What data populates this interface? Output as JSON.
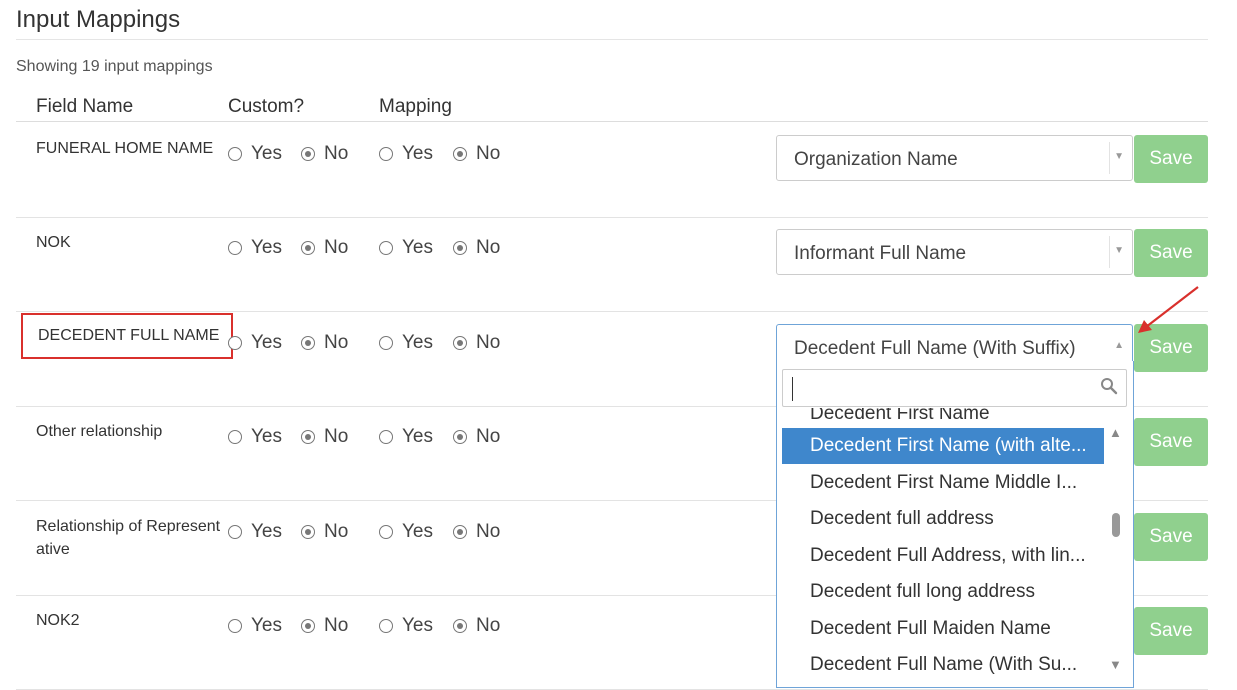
{
  "page": {
    "title": "Input Mappings",
    "count_text": "Showing 19 input mappings",
    "columns": {
      "field_name": "Field Name",
      "custom": "Custom?",
      "mapping": "Mapping"
    }
  },
  "radio_labels": {
    "yes": "Yes",
    "no": "No"
  },
  "rows": [
    {
      "field_name": "FUNERAL HOME NAME",
      "custom": "No",
      "mapping": "No",
      "select_value": "Organization Name",
      "save_label": "Save"
    },
    {
      "field_name": "NOK",
      "custom": "No",
      "mapping": "No",
      "select_value": "Informant Full Name",
      "save_label": "Save"
    },
    {
      "field_name": "DECEDENT FULL NAME",
      "custom": "No",
      "mapping": "No",
      "select_value": "Decedent Full Name (With Suffix)",
      "save_label": "Save",
      "highlighted": true
    },
    {
      "field_name": "Other relationship",
      "custom": "No",
      "mapping": "No",
      "select_value": "",
      "save_label": "Save"
    },
    {
      "field_name": "Relationship of Representative",
      "custom": "No",
      "mapping": "No",
      "select_value": "",
      "save_label": "Save"
    },
    {
      "field_name": "NOK2",
      "custom": "No",
      "mapping": "No",
      "select_value": "",
      "save_label": "Save"
    }
  ],
  "dropdown": {
    "search_value": "",
    "options": [
      {
        "label": "Decedent First Name",
        "state": "partially-visible"
      },
      {
        "label": "Decedent First Name (with alte...",
        "state": "highlighted"
      },
      {
        "label": "Decedent First Name Middle I...",
        "state": "normal"
      },
      {
        "label": "Decedent full address",
        "state": "normal"
      },
      {
        "label": "Decedent Full Address, with lin...",
        "state": "normal"
      },
      {
        "label": "Decedent full long address",
        "state": "normal"
      },
      {
        "label": "Decedent Full Maiden Name",
        "state": "normal"
      },
      {
        "label": "Decedent Full Name (With Su...",
        "state": "normal"
      }
    ]
  },
  "colors": {
    "save_button": "#90d08e",
    "highlight": "#3f87cc",
    "annotation": "#d9302c",
    "dropdown_border": "#6fa4d8"
  },
  "icons": [
    "search-icon",
    "chevron-down-icon",
    "chevron-up-icon",
    "scroll-up-icon",
    "scroll-down-icon",
    "annotation-arrow"
  ]
}
